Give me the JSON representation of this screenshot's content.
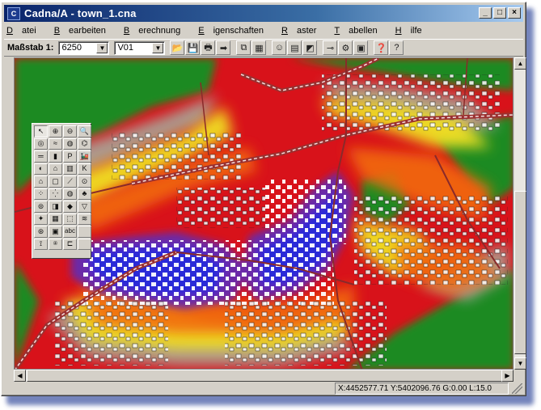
{
  "window": {
    "title": "Cadna/A - town_1.cna",
    "app_icon": "cadna-app-icon",
    "controls": [
      {
        "name": "minimize-button",
        "glyph": "_"
      },
      {
        "name": "maximize-button",
        "glyph": "□"
      },
      {
        "name": "close-button",
        "glyph": "×"
      }
    ]
  },
  "menu": [
    {
      "label": "Datei",
      "u": "D",
      "rest": "atei"
    },
    {
      "label": "Bearbeiten",
      "u": "B",
      "rest": "earbeiten"
    },
    {
      "label": "Berechnung",
      "u": "B",
      "rest": "erechnung"
    },
    {
      "label": "Eigenschaften",
      "u": "E",
      "rest": "igenschaften"
    },
    {
      "label": "Raster",
      "u": "R",
      "rest": "aster"
    },
    {
      "label": "Tabellen",
      "u": "T",
      "rest": "abellen"
    },
    {
      "label": "Hilfe",
      "u": "H",
      "rest": "ilfe"
    }
  ],
  "toolbar": {
    "scale_label": "Maßstab 1:",
    "scale_value": "6250",
    "variant_value": "V01",
    "buttons": [
      {
        "icon": "open-folder-icon",
        "glyph": "📂"
      },
      {
        "icon": "save-icon",
        "glyph": "💾"
      },
      {
        "icon": "print-icon",
        "glyph": "🖶"
      },
      {
        "icon": "export-arrow-icon",
        "glyph": "➡"
      },
      {
        "icon": "copy-icon",
        "glyph": "⧉"
      },
      {
        "icon": "table-icon",
        "glyph": "▦"
      },
      {
        "icon": "smiley-icon",
        "glyph": "☺"
      },
      {
        "icon": "calculator-icon",
        "glyph": "▤"
      },
      {
        "icon": "grid-map-icon",
        "glyph": "◩"
      },
      {
        "icon": "pushpin-icon",
        "glyph": "⊸"
      },
      {
        "icon": "settings-icon",
        "glyph": "⚙"
      },
      {
        "icon": "layers-icon",
        "glyph": "▣"
      },
      {
        "icon": "context-help-icon",
        "glyph": "❓"
      },
      {
        "icon": "help-icon",
        "glyph": "?"
      }
    ]
  },
  "palette": [
    {
      "icon": "pointer-arrow-icon",
      "glyph": "↖",
      "selected": true
    },
    {
      "icon": "zoom-in-icon",
      "glyph": "⊕"
    },
    {
      "icon": "zoom-out-icon",
      "glyph": "⊖"
    },
    {
      "icon": "zoom-window-icon",
      "glyph": "🔍"
    },
    {
      "icon": "point-source-icon",
      "glyph": "◎"
    },
    {
      "icon": "line-source-icon",
      "glyph": "≈"
    },
    {
      "icon": "area-source-icon",
      "glyph": "◍"
    },
    {
      "icon": "vertical-area-icon",
      "glyph": "⌬"
    },
    {
      "icon": "road-icon",
      "glyph": "═"
    },
    {
      "icon": "traffic-light-icon",
      "glyph": "▮"
    },
    {
      "icon": "parking-lot-icon",
      "glyph": "P"
    },
    {
      "icon": "railway-icon",
      "glyph": "🚂"
    },
    {
      "icon": "tennis-icon",
      "glyph": "◐"
    },
    {
      "icon": "industry-icon",
      "glyph": "⌂"
    },
    {
      "icon": "barrier-icon",
      "glyph": "▥"
    },
    {
      "icon": "k-factor-icon",
      "glyph": "K"
    },
    {
      "icon": "building-icon",
      "glyph": "⌂"
    },
    {
      "icon": "building-outline-icon",
      "glyph": "▢"
    },
    {
      "icon": "bridge-icon",
      "glyph": "⟋"
    },
    {
      "icon": "cylinder-icon",
      "glyph": "⊙"
    },
    {
      "icon": "dots-grid-icon",
      "glyph": "⁘"
    },
    {
      "icon": "scatter-icon",
      "glyph": "⁛"
    },
    {
      "icon": "ground-absorption-icon",
      "glyph": "◍"
    },
    {
      "icon": "tree-icon",
      "glyph": "♣"
    },
    {
      "icon": "layer-icon",
      "glyph": "⊜"
    },
    {
      "icon": "3d-box-icon",
      "glyph": "◨"
    },
    {
      "icon": "leaf-area-icon",
      "glyph": "◆"
    },
    {
      "icon": "dropdown-triangle-icon",
      "glyph": "▽"
    },
    {
      "icon": "receiver-icon",
      "glyph": "✦"
    },
    {
      "icon": "grid-calculation-icon",
      "glyph": "▦"
    },
    {
      "icon": "polygon-icon",
      "glyph": "⬚"
    },
    {
      "icon": "contour-line-icon",
      "glyph": "≋"
    },
    {
      "icon": "globe-icon",
      "glyph": "⊛"
    },
    {
      "icon": "bitmap-icon",
      "glyph": "▣"
    },
    {
      "icon": "text-abc-icon",
      "glyph": "abc"
    },
    {
      "icon": "blank-tool-icon",
      "glyph": ""
    },
    {
      "icon": "measure-icon",
      "glyph": "⟟"
    },
    {
      "icon": "symbol-icon",
      "glyph": "⍟"
    },
    {
      "icon": "label-icon",
      "glyph": "⊏"
    },
    {
      "icon": "blank-tool-2-icon",
      "glyph": ""
    }
  ],
  "status": {
    "coords": "X:4452577.71 Y:5402096.76 G:0.00 L:15.0"
  },
  "colors": {
    "title_start": "#0a246a",
    "title_end": "#a6caf0",
    "map_red": "#d8121a",
    "map_orange": "#f26a10",
    "map_yellow": "#f0e020",
    "map_grey": "#a8a89a",
    "map_green": "#1d8a20",
    "map_blue": "#2b2bd8",
    "map_purple": "#6a2aa8"
  }
}
